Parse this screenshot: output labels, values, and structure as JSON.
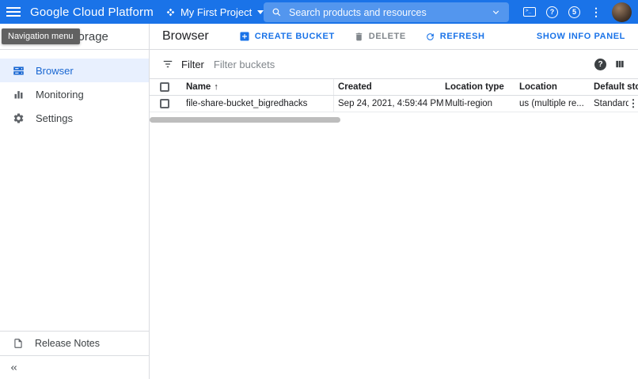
{
  "topbar": {
    "brand": "Google Cloud Platform",
    "project": "My First Project",
    "search_placeholder": "Search products and resources",
    "notification_count": "5"
  },
  "tooltip": "Navigation menu",
  "sidebar": {
    "title": "Cloud Storage",
    "items": [
      {
        "label": "Browser",
        "active": true
      },
      {
        "label": "Monitoring",
        "active": false
      },
      {
        "label": "Settings",
        "active": false
      }
    ],
    "release_notes": "Release Notes"
  },
  "main": {
    "title": "Browser",
    "actions": {
      "create": "CREATE BUCKET",
      "delete": "DELETE",
      "refresh": "REFRESH",
      "info_panel": "SHOW INFO PANEL"
    },
    "filter": {
      "label": "Filter",
      "placeholder": "Filter buckets"
    },
    "table": {
      "columns": [
        "Name",
        "Created",
        "Location type",
        "Location",
        "Default sto"
      ],
      "rows": [
        {
          "name": "file-share-bucket_bigredhacks",
          "created": "Sep 24, 2021, 4:59:44 PM",
          "location_type": "Multi-region",
          "location": "us (multiple re...",
          "default_storage": "Standard"
        }
      ]
    }
  },
  "icons": {
    "more": "⋮",
    "help": "?",
    "sort_asc": "↑",
    "terminal": ">_"
  },
  "colors": {
    "header_blue": "#1a73e8",
    "accent_blue": "#1a73e8",
    "active_item_bg": "#e8f0fe",
    "active_item_text": "#1967d2",
    "disabled_text": "#80868b",
    "tooltip_bg": "#616161"
  }
}
